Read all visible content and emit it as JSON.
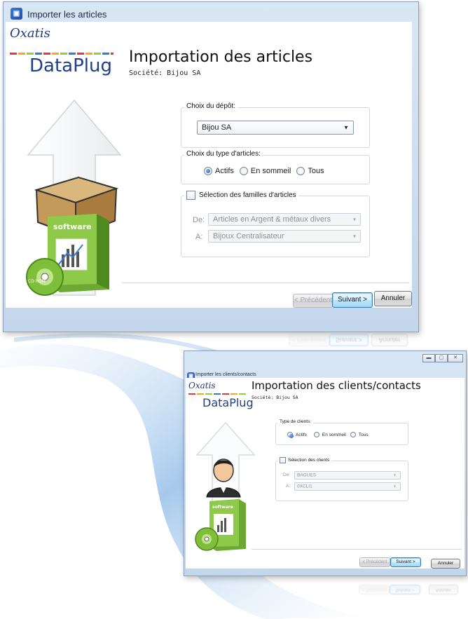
{
  "articles_window": {
    "title": "Importer les articles",
    "brand_top": "Oxatis",
    "brand_product": "DataPlug",
    "heading": "Importation des articles",
    "company": "Société: Bijou SA",
    "depot_group": {
      "legend": "Choix du dépôt:",
      "selected": "Bijou SA"
    },
    "type_group": {
      "legend": "Choix du type d'articles:",
      "options": [
        "Actifs",
        "En sommeil",
        "Tous"
      ],
      "selected": "Actifs"
    },
    "families_group": {
      "legend": "Sélection des familles d'articles",
      "checked": false,
      "from_label": "De:",
      "from_value": "Articles en Argent & métaux divers",
      "to_label": "A:",
      "to_value": "Bijoux Centralisateur"
    },
    "buttons": {
      "prev": "< Précédent",
      "next": "Suivant >",
      "cancel": "Annuler"
    },
    "illustration": {
      "box_label": "software",
      "cd_label": "CD ROM"
    }
  },
  "clients_window": {
    "title": "Importer les clients/contacts",
    "brand_top": "Oxatis",
    "brand_product": "DataPlug",
    "heading": "Importation des clients/contacts",
    "company": "Société: Bijou SA",
    "type_group": {
      "legend": "Type de clients:",
      "options": [
        "Actifs",
        "En sommeil",
        "Tous"
      ],
      "selected": "Actifs"
    },
    "clients_group": {
      "legend": "Sélection des clients",
      "checked": false,
      "from_label": "De:",
      "from_value": "BAGUES",
      "to_label": "A:",
      "to_value": "0XCLI1"
    },
    "buttons": {
      "prev": "< Précédent",
      "next": "Suivant >",
      "cancel": "Annuler"
    },
    "illustration": {
      "box_label": "software"
    }
  },
  "colors": {
    "accent": "#1d5fb8",
    "brand_blue": "#1f3f8a",
    "frame": "#c4d6ec",
    "box_green": "#7bb53a"
  }
}
